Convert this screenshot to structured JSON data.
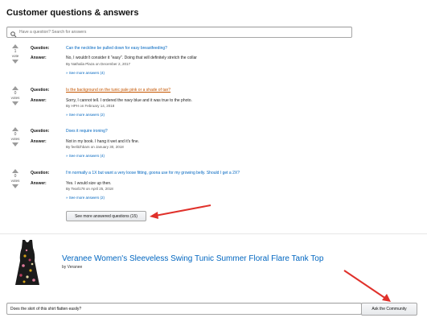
{
  "section_title": "Customer questions & answers",
  "search": {
    "placeholder": "Have a question? Search for answers"
  },
  "labels": {
    "question": "Question:",
    "answer": "Answer:",
    "votes": "votes",
    "vote": "vote"
  },
  "qa_items": [
    {
      "votes": "1",
      "vote_label": "vote",
      "question": "Can the neckline be pulled down for easy breastfeeding?",
      "question_visited": false,
      "answer": "No, I wouldn't consider it \"easy\". Doing that will definitely stretch the collar",
      "by": "By Nathalia Plaza on December 2, 2017",
      "more": "» See more answers (4)"
    },
    {
      "votes": "0",
      "vote_label": "votes",
      "question": "Is the background on the tunic pale pink or a shade of tan?",
      "question_visited": true,
      "answer": "Sorry, I cannot tell. I ordered the navy blue and it was true to the photo.",
      "by": "By HPH on February 14, 2018",
      "more": "» See more answers (2)"
    },
    {
      "votes": "0",
      "vote_label": "votes",
      "question": "Does it require ironing?",
      "question_visited": false,
      "answer": "Not in my book. I hang it wet and it's fine.",
      "by": "By feelitzhbars on January 30, 2018",
      "more": "» See more answers (4)"
    },
    {
      "votes": "0",
      "vote_label": "votes",
      "question": "I'm normally a 1X but want a very loose fitting, goona use for my growing belly. Should I get a 2X?",
      "question_visited": false,
      "answer": "Yes. I would size up then.",
      "by": "By Tearl178 on April 25, 2018",
      "more": "» See more answers (2)"
    }
  ],
  "more_questions_button": "See more answered questions (15)",
  "product": {
    "title": "Veranee Women's Sleeveless Swing Tunic Summer Floral Flare Tank Top",
    "by": "by Veranee"
  },
  "ask": {
    "value": "Does the skirt of this shirt flatten easily?",
    "button": "Ask the Community"
  },
  "colors": {
    "link": "#0066c0",
    "visited_link": "#c45500",
    "annotation_arrow": "#e0312b"
  }
}
